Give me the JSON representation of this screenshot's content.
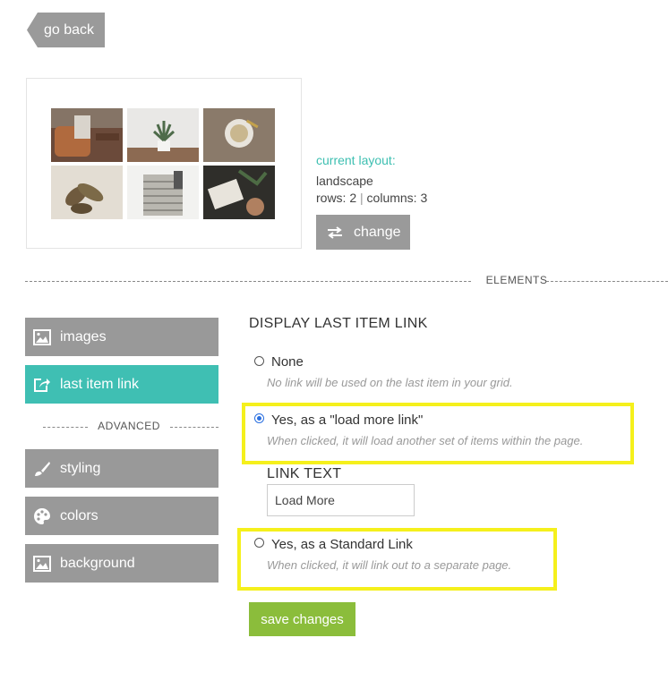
{
  "nav": {
    "go_back_label": "go back"
  },
  "layout": {
    "heading": "current layout:",
    "name": "landscape",
    "rows_text": "rows: 2",
    "separator": "|",
    "columns_text": "columns: 3",
    "change_label": "change"
  },
  "divider": {
    "elements_label": "ELEMENTS"
  },
  "sidebar": {
    "items": [
      {
        "label": "images"
      },
      {
        "label": "last item link",
        "active": true
      },
      {
        "label": "styling"
      },
      {
        "label": "colors"
      },
      {
        "label": "background"
      }
    ],
    "advanced_label": "ADVANCED"
  },
  "main": {
    "title": "DISPLAY LAST ITEM LINK",
    "options": [
      {
        "label": "None",
        "desc": "No link will be used on the last item in your grid.",
        "checked": false
      },
      {
        "label": "Yes, as a \"load more link\"",
        "desc": "When clicked, it will load another set of items within the page.",
        "checked": true
      },
      {
        "label": "Yes, as a Standard Link",
        "desc": "When clicked, it will link out to a separate page.",
        "checked": false
      }
    ],
    "link_text_label": "LINK TEXT",
    "link_text_value": "Load More",
    "save_label": "save changes"
  },
  "colors": {
    "accent_teal": "#3fbfb3",
    "button_gray": "#999999",
    "save_green": "#8bbd3b",
    "highlight_yellow": "#f5f01c",
    "radio_blue": "#2a6fe0"
  },
  "icons": {
    "change": "swap-arrows-icon",
    "images": "image-icon",
    "last_item_link": "share-link-icon",
    "styling": "brush-icon",
    "colors": "palette-icon",
    "background": "image-icon"
  }
}
